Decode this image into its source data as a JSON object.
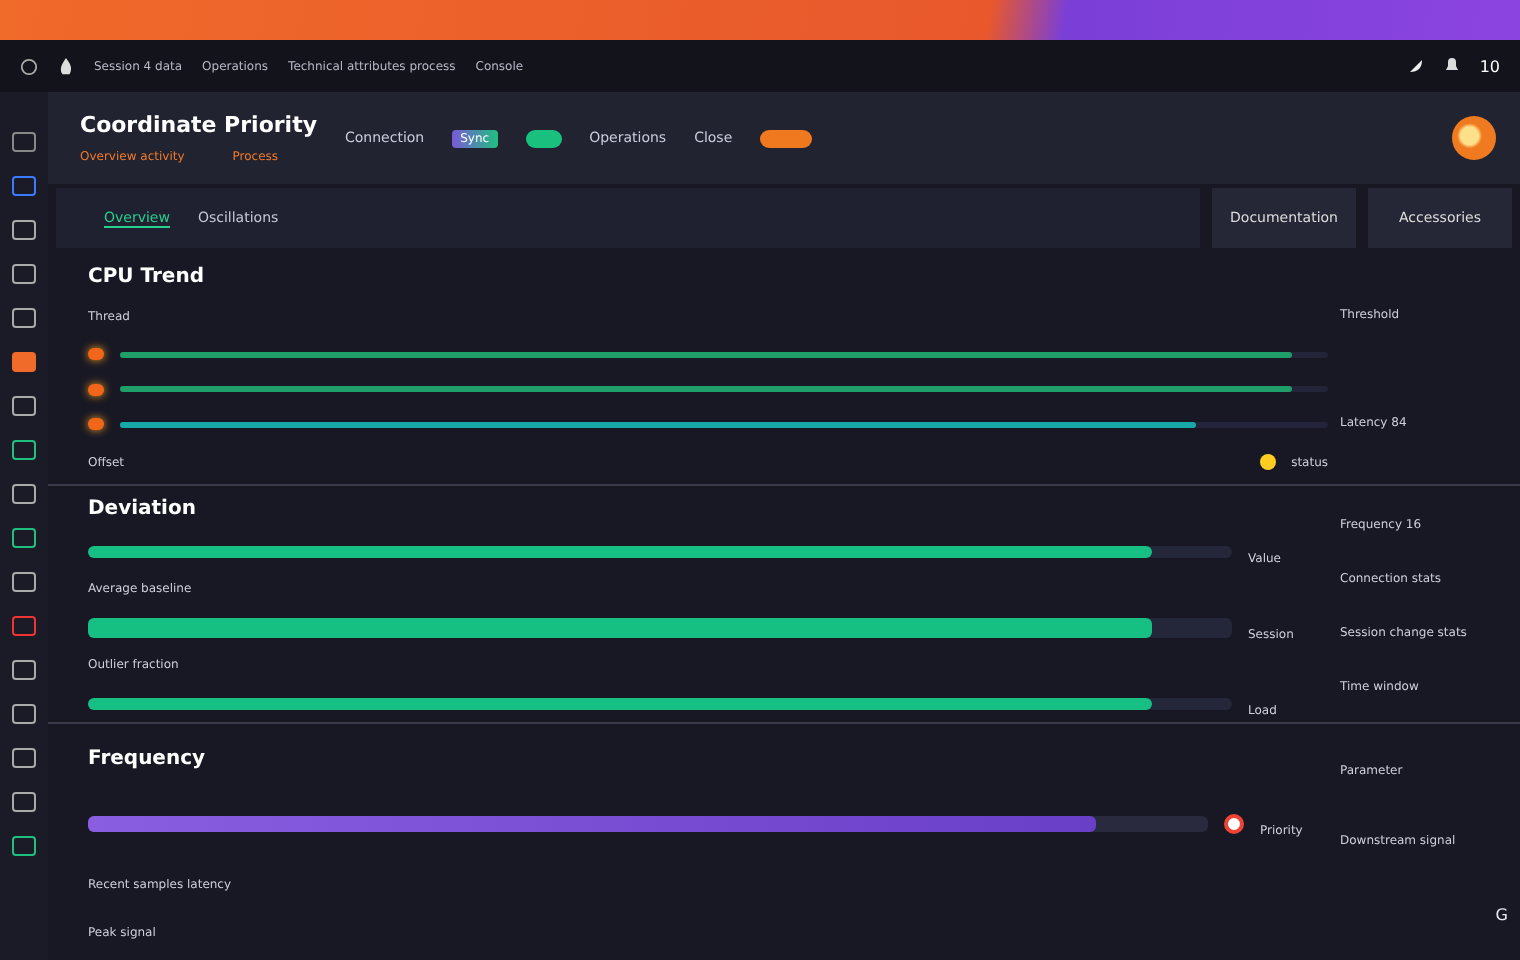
{
  "top_menu": [
    "Session 4 data",
    "Operations",
    "Technical attributes process",
    "Console"
  ],
  "status_value": "10",
  "header": {
    "title": "Coordinate Priority",
    "tags": [
      "Overview activity",
      "Process"
    ],
    "connection": "Connection",
    "badge": "Sync",
    "toggle_on": true,
    "operations": "Operations",
    "close": "Close"
  },
  "tabs": [
    {
      "label": "Overview",
      "selected": true
    },
    {
      "label": "Oscillations",
      "selected": false
    }
  ],
  "actions": [
    "Documentation",
    "Accessories"
  ],
  "cpu": {
    "title": "CPU Trend",
    "caption": "Thread",
    "footer": "Offset",
    "marker": "status",
    "side": [
      "Threshold",
      "Latency 84"
    ],
    "lines": [
      {
        "level": 0.97,
        "color": "#1f9e6a"
      },
      {
        "level": 0.97,
        "color": "#1f9e6a"
      },
      {
        "level": 0.89,
        "color": "#17a8a8"
      }
    ]
  },
  "deviation": {
    "title": "Deviation",
    "notes": [
      "Average baseline",
      "Outlier fraction"
    ],
    "side": [
      "Frequency 16",
      "Connection stats",
      "Session change stats",
      "Time window"
    ],
    "bars": [
      {
        "level": 0.93,
        "reading": "Value"
      },
      {
        "level": 0.93,
        "reading": "Session"
      },
      {
        "level": 0.93,
        "reading": "Load"
      }
    ]
  },
  "frequency": {
    "title": "Frequency",
    "level": 0.9,
    "reading": "Priority",
    "captions": [
      "Recent samples latency",
      "Peak signal"
    ],
    "side": [
      "Parameter",
      "Downstream signal"
    ],
    "corner": "G"
  }
}
